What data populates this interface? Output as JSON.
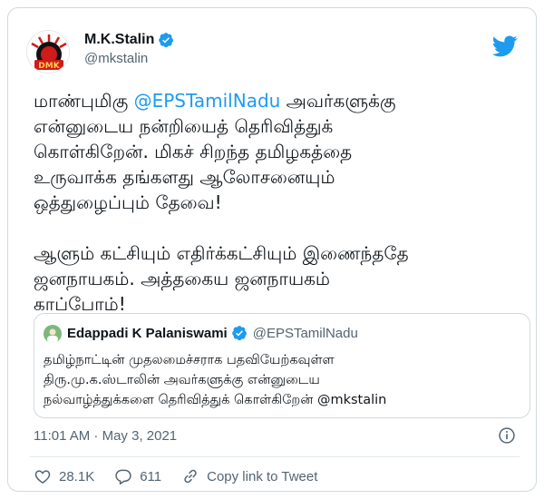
{
  "tweet": {
    "author": {
      "name": "M.K.Stalin",
      "handle": "@mkstalin",
      "avatar_text": "DMK"
    },
    "text_before": "மாண்புமிகு ",
    "mention": "@EPSTamilNadu",
    "text_after": " அவர்களுக்கு\nஎன்னுடைய நன்றியைத் தெரிவித்துக்\nகொள்கிறேன். மிகச் சிறந்த தமிழகத்தை\nஉருவாக்க தங்களது ஆலோசனையும்\nஒத்துழைப்பும் தேவை!\n\nஆளும் கட்சியும் எதிர்க்கட்சியும் இணைந்ததே\nஜனநாயகம். அத்தகைய ஜனநாயகம்\nகாப்போம்!",
    "quoted": {
      "name": "Edappadi K Palaniswami",
      "handle": "@EPSTamilNadu",
      "text": "தமிழ்நாட்டின் முதலமைச்சராக பதவியேற்கவுள்ள\nதிரு.மு.க.ஸ்டாலின் அவர்களுக்கு என்னுடைய\nநல்வாழ்த்துக்களை தெரிவித்துக் கொள்கிறேன் @mkstalin"
    },
    "timestamp": "11:01 AM · May 3, 2021",
    "likes": "28.1K",
    "replies": "611",
    "copy_link_label": "Copy link to Tweet"
  },
  "icons": {
    "verified": "verified-badge-icon",
    "bird": "twitter-bird-icon",
    "info": "info-icon",
    "like": "heart-icon",
    "reply": "reply-bubble-icon",
    "share": "link-icon"
  },
  "colors": {
    "accent": "#1d9bf0",
    "text": "#0f1419",
    "muted": "#536471",
    "border": "#cfd9de"
  }
}
